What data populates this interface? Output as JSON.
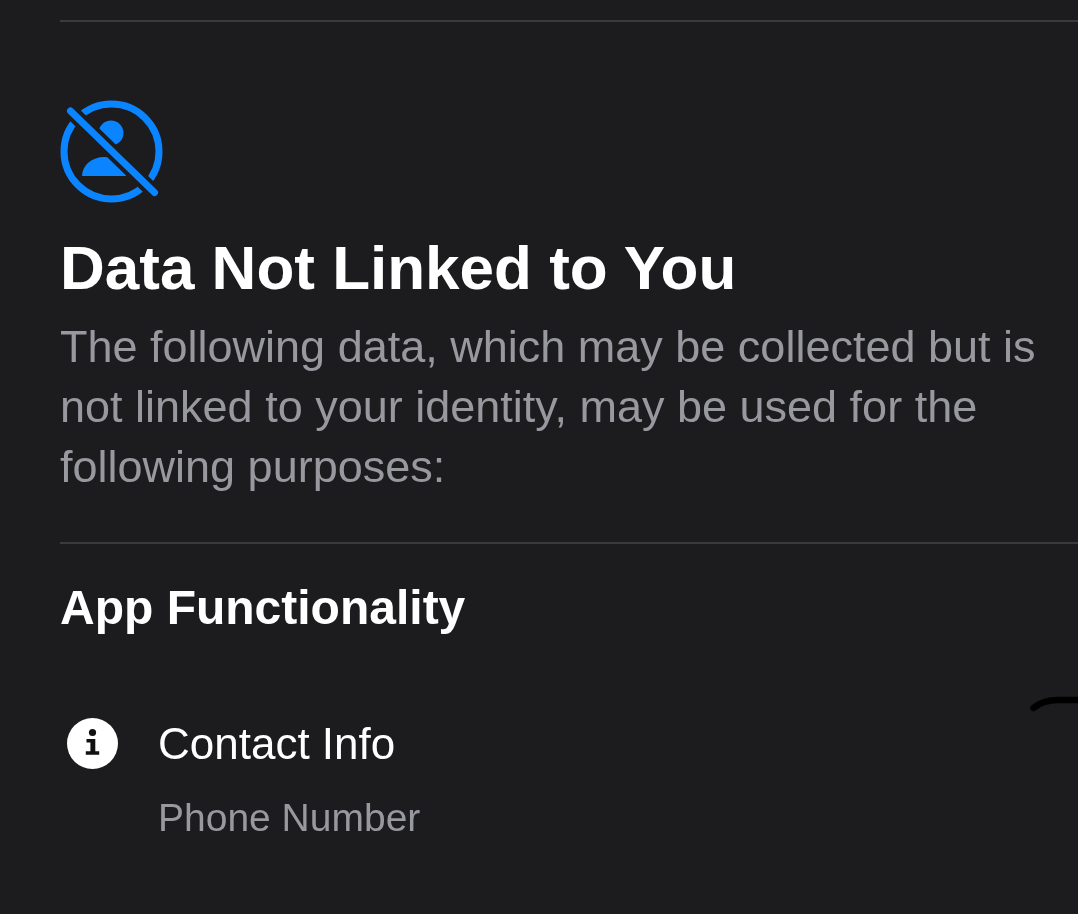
{
  "section": {
    "title": "Data Not Linked to You",
    "description": "The following data, which may be collected but is not linked to your identity, may be used for the following purposes:"
  },
  "categories": [
    {
      "title": "App Functionality",
      "items": [
        {
          "kind": "info",
          "title": "Contact Info",
          "detail": "Phone Number"
        }
      ]
    }
  ]
}
